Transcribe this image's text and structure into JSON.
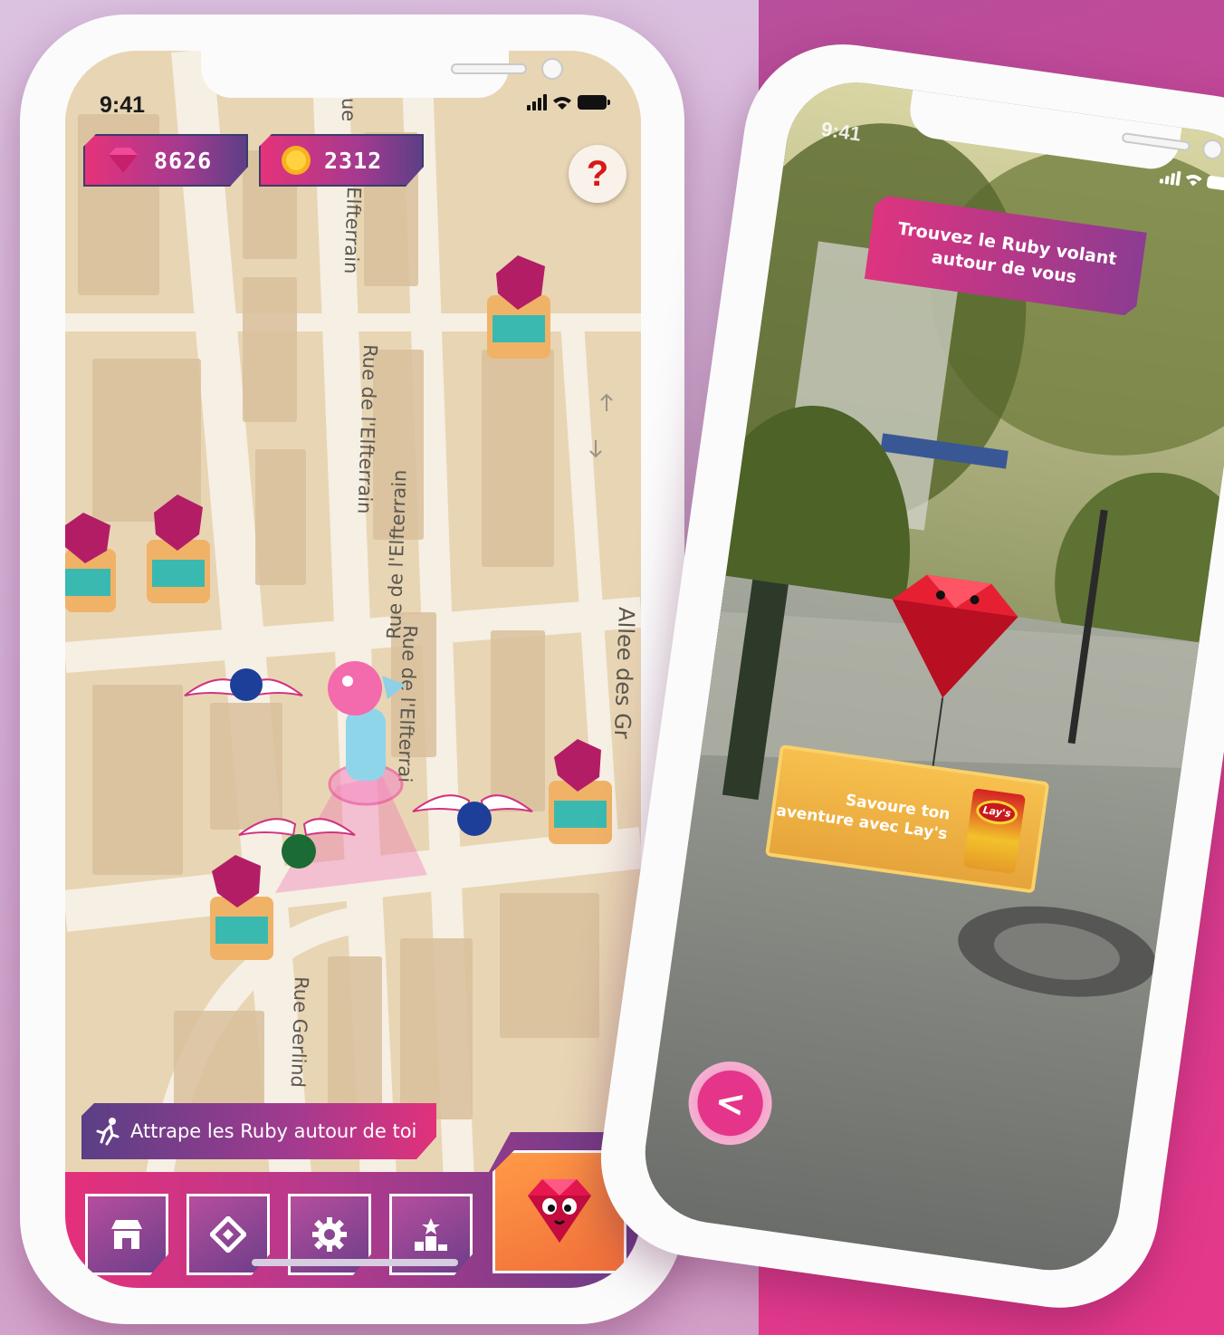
{
  "map_phone": {
    "status_time": "9:41",
    "gems_count": "8626",
    "coins_count": "2312",
    "help_label": "?",
    "streets": [
      "ue",
      "Elfterrain",
      "Rue de l'Elfterrain",
      "Rue de l'Elfterrain",
      "Rue de l'Elfterrai",
      "Allee des Gr",
      "Rue Gerlind"
    ],
    "mission_text": "Attrape les Ruby autour de toi",
    "tabs": [
      {
        "icon": "shop-icon"
      },
      {
        "icon": "ticket-icon"
      },
      {
        "icon": "gear-icon"
      },
      {
        "icon": "podium-icon"
      }
    ],
    "ruby_button_icon": "ruby-mascot-icon"
  },
  "ar_phone": {
    "status_time": "9:41",
    "prompt_text": "Trouvez le Ruby volant autour de vous",
    "ad_text": "Savoure ton aventure avec Lay's",
    "ad_brand": "Lay's",
    "back_label": "<"
  },
  "colors": {
    "accent_pink": "#e5327c",
    "accent_purple": "#6a3d87",
    "ruby_orange": "#f5803f",
    "gold": "#f1b443"
  }
}
